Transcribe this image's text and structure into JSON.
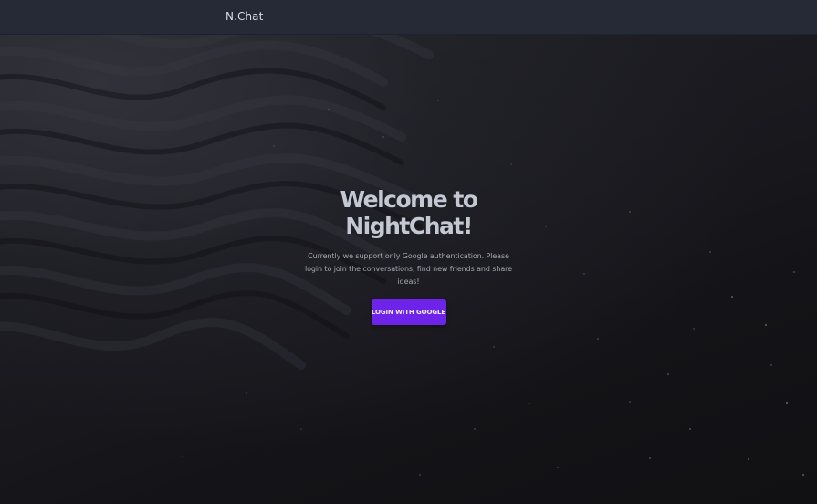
{
  "navbar": {
    "brand": "N.Chat"
  },
  "hero": {
    "title_line1": "Welcome to",
    "title_line2": "NightChat!",
    "description": "Currently we support only Google authentication. Please login to join the conversations, find new friends and share ideas!",
    "login_button": "LOGIN WITH GOOGLE"
  },
  "colors": {
    "navbar_bg": "#252a36",
    "page_bg": "#17171c",
    "accent": "#6d24e8",
    "title_text": "#c4c8d3"
  }
}
